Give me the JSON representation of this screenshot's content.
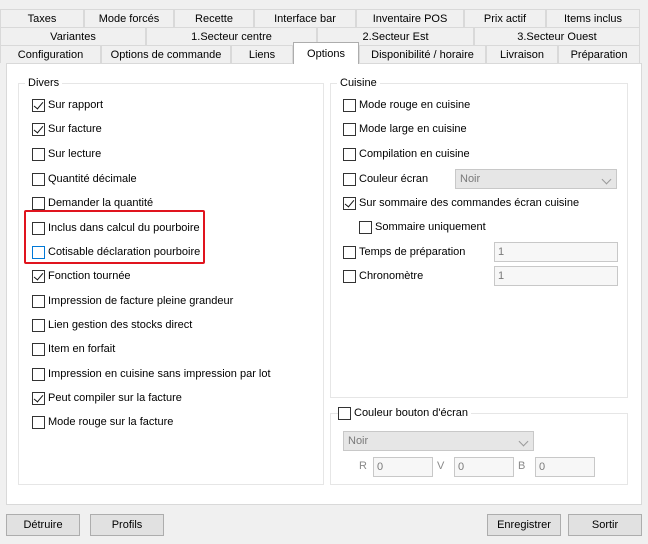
{
  "tabs": {
    "row1": [
      "Taxes",
      "Mode forcés",
      "Recette",
      "Interface bar",
      "Inventaire POS",
      "Prix actif",
      "Items inclus"
    ],
    "row2": [
      "Variantes",
      "1.Secteur centre",
      "2.Secteur Est",
      "3.Secteur Ouest"
    ],
    "row3": [
      "Configuration",
      "Options de commande",
      "Liens",
      "Options",
      "Disponibilité / horaire",
      "Livraison",
      "Préparation"
    ],
    "active": "Options"
  },
  "divers": {
    "title": "Divers",
    "items": [
      {
        "label": "Sur rapport",
        "checked": true
      },
      {
        "label": "Sur facture",
        "checked": true
      },
      {
        "label": "Sur lecture",
        "checked": false
      },
      {
        "label": "Quantité décimale",
        "checked": false
      },
      {
        "label": "Demander la quantité",
        "checked": false
      },
      {
        "label": "Inclus dans calcul du pourboire",
        "checked": false
      },
      {
        "label": "Cotisable déclaration pourboire",
        "checked": false
      },
      {
        "label": "Fonction tournée",
        "checked": true
      },
      {
        "label": "Impression de facture pleine grandeur",
        "checked": false
      },
      {
        "label": "Lien gestion des stocks direct",
        "checked": false
      },
      {
        "label": "Item en forfait",
        "checked": false
      },
      {
        "label": "Impression en cuisine sans impression par lot",
        "checked": false
      },
      {
        "label": "Peut compiler sur la facture",
        "checked": true
      },
      {
        "label": "Mode rouge sur la facture",
        "checked": false
      }
    ]
  },
  "cuisine": {
    "title": "Cuisine",
    "items": [
      {
        "label": "Mode rouge en cuisine",
        "checked": false
      },
      {
        "label": "Mode large en cuisine",
        "checked": false
      },
      {
        "label": "Compilation en cuisine",
        "checked": false
      },
      {
        "label": "Couleur écran",
        "checked": false
      },
      {
        "label": "Sur sommaire des commandes écran cuisine",
        "checked": true
      },
      {
        "label": "Sommaire uniquement",
        "checked": false
      },
      {
        "label": "Temps de préparation",
        "checked": false
      },
      {
        "label": "Chronomètre",
        "checked": false
      }
    ],
    "couleur_ecran_value": "Noir",
    "temps_value": "1",
    "chrono_value": "1"
  },
  "couleur_bouton": {
    "title": "Couleur bouton d'écran",
    "checked": false,
    "select_value": "Noir",
    "r_label": "R",
    "r_value": "0",
    "v_label": "V",
    "v_value": "0",
    "b_label": "B",
    "b_value": "0"
  },
  "footer": {
    "detruire": "Détruire",
    "profils": "Profils",
    "enregistrer": "Enregistrer",
    "sortir": "Sortir"
  }
}
